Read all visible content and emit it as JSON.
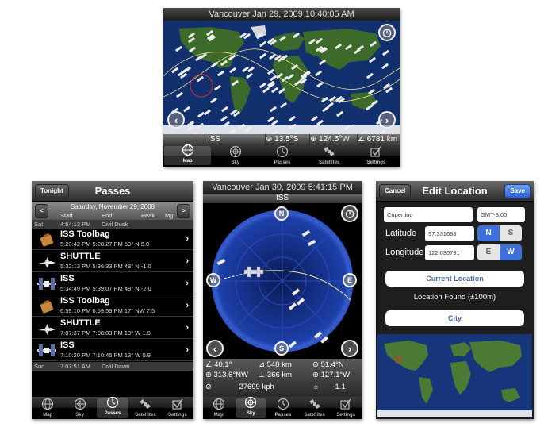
{
  "map_screen": {
    "status": "Vancouver  Jan 29, 2009 10:40:05 AM",
    "sat_name": "ISS",
    "lat": "13.5°S",
    "lon": "124.5°W",
    "alt": "6781 km"
  },
  "tabs": [
    "Map",
    "Sky",
    "Passes",
    "Satellites",
    "Settings"
  ],
  "passes": {
    "back": "Tonight",
    "title": "Passes",
    "date": "Saturday, November 29, 2008",
    "prev": "<",
    "next": ">",
    "cols": [
      "Start",
      "End",
      "Peak",
      "Mg"
    ],
    "rows": [
      {
        "type": "sec",
        "day": "Sat",
        "time": "4:54:13 PM",
        "label": "Civil Dusk"
      },
      {
        "type": "pass",
        "name": "ISS Toolbag",
        "detail": "5:23:42 PM   5:28:27 PM   50° N    5.0",
        "icon": "toolbag-icon"
      },
      {
        "type": "pass",
        "name": "SHUTTLE",
        "detail": "5:32:13 PM   5:36:33 PM   48° N   -1.0",
        "icon": "shuttle-icon"
      },
      {
        "type": "pass",
        "name": "ISS",
        "detail": "5:34:49 PM   5:39:07 PM   48° N   -2.0",
        "icon": "iss-icon"
      },
      {
        "type": "pass",
        "name": "ISS Toolbag",
        "detail": "6:59:10 PM   6:59:59 PM   17° NW 7.5",
        "icon": "toolbag-icon"
      },
      {
        "type": "pass",
        "name": "SHUTTLE",
        "detail": "7:07:37 PM   7:08:03 PM   13° W   1.9",
        "icon": "shuttle-icon"
      },
      {
        "type": "pass",
        "name": "ISS",
        "detail": "7:10:20 PM   7:10:45 PM   13° W   0.9",
        "icon": "iss-icon"
      },
      {
        "type": "sec",
        "day": "Sun",
        "time": "7:07:51 AM",
        "label": "Civil Dawn"
      }
    ]
  },
  "sky": {
    "status": "Vancouver  Jan 30, 2009 5:41:15 PM",
    "sat_name": "ISS",
    "n": "N",
    "e": "E",
    "s": "S",
    "w": "W",
    "az": "40.1°",
    "range": "548 km",
    "lat": "51.4°N",
    "el": "313.6°NW",
    "alt": "366 km",
    "lon": "127.1°W",
    "speed": "27699 kph",
    "mag": "-1.1"
  },
  "edit": {
    "cancel": "Cancel",
    "title": "Edit Location",
    "save": "Save",
    "city": "Cupertino",
    "tz": "GMT-8:00",
    "lat_label": "Latitude",
    "lat": "37.331688",
    "ns_n": "N",
    "ns_s": "S",
    "lon_label": "Longitude",
    "lon": "122.030731",
    "ew_e": "E",
    "ew_w": "W",
    "current": "Current Location",
    "found": "Location Found (±100m)",
    "city_btn": "City"
  }
}
